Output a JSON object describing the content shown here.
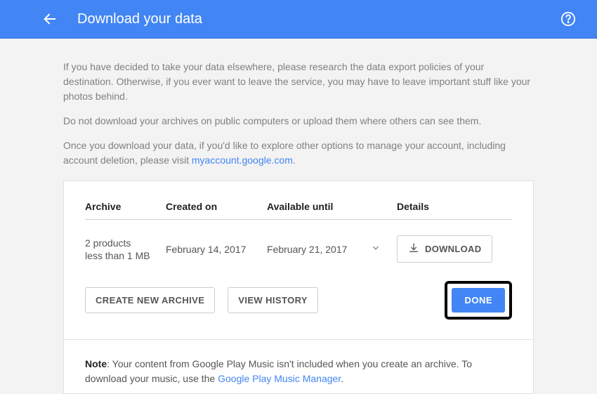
{
  "header": {
    "title": "Download your data"
  },
  "intro": {
    "p1": "If you have decided to take your data elsewhere, please research the data export policies of your destination. Otherwise, if you ever want to leave the service, you may have to leave important stuff like your photos behind.",
    "p2": "Do not download your archives on public computers or upload them where others can see them.",
    "p3_a": "Once you download your data, if you'd like to explore other options to manage your account, including account deletion, please visit ",
    "p3_link": "myaccount.google.com",
    "p3_b": "."
  },
  "table": {
    "headers": {
      "archive": "Archive",
      "created": "Created on",
      "available": "Available until",
      "details": "Details"
    },
    "row": {
      "archive_line1": "2 products",
      "archive_line2": "less than 1 MB",
      "created": "February 14, 2017",
      "available": "February 21, 2017",
      "download_label": "DOWNLOAD"
    }
  },
  "actions": {
    "create": "CREATE NEW ARCHIVE",
    "history": "VIEW HISTORY",
    "done": "DONE"
  },
  "note": {
    "prefix": "Note",
    "text_a": ": Your content from Google Play Music isn't included when you create an archive. To download your music, use the ",
    "link": "Google Play Music Manager",
    "text_b": "."
  }
}
